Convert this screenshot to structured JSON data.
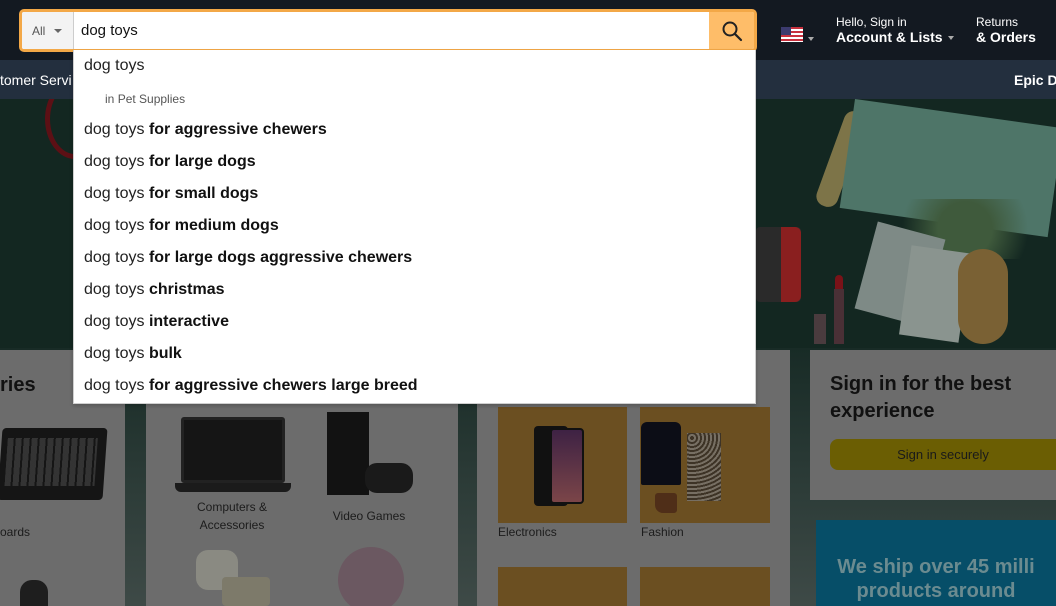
{
  "header": {
    "search_category": "All",
    "search_value": "dog toys",
    "search_icon": "magnifier",
    "locale_flag": "us-flag",
    "account_greeting": "Hello, Sign in",
    "account_label": "Account & Lists",
    "returns_line1": "Returns",
    "returns_line2": "& Orders"
  },
  "subnav": {
    "customer_service": "tomer Servi",
    "promo": "Epic D"
  },
  "autocomplete": {
    "suggestions": [
      {
        "base": "dog toys",
        "completion": ""
      },
      {
        "base": "dog toys ",
        "completion": "for aggressive chewers"
      },
      {
        "base": "dog toys ",
        "completion": "for large dogs"
      },
      {
        "base": "dog toys ",
        "completion": "for small dogs"
      },
      {
        "base": "dog toys ",
        "completion": "for medium dogs"
      },
      {
        "base": "dog toys ",
        "completion": "for large dogs aggressive chewers"
      },
      {
        "base": "dog toys ",
        "completion": "christmas"
      },
      {
        "base": "dog toys ",
        "completion": "interactive"
      },
      {
        "base": "dog toys ",
        "completion": "bulk"
      },
      {
        "base": "dog toys ",
        "completion": "for aggressive chewers large breed"
      }
    ],
    "department_prefix": "in ",
    "department": "Pet Supplies"
  },
  "cards": {
    "left_title": "ries",
    "left_tile_label": "oards",
    "mid_tiles": [
      {
        "label": "Computers & Accessories"
      },
      {
        "label": "Video Games"
      }
    ],
    "right_tiles": [
      {
        "label": "Electronics"
      },
      {
        "label": "Fashion"
      }
    ],
    "signin_title": "Sign in for the best experience",
    "signin_button": "Sign in securely",
    "ship_text_line1": "We ship over 45 milli",
    "ship_text_line2": "products around"
  },
  "colors": {
    "nav_bg": "#131921",
    "subnav_bg": "#232f3e",
    "search_accent": "#f3a847",
    "search_button": "#febd69"
  }
}
